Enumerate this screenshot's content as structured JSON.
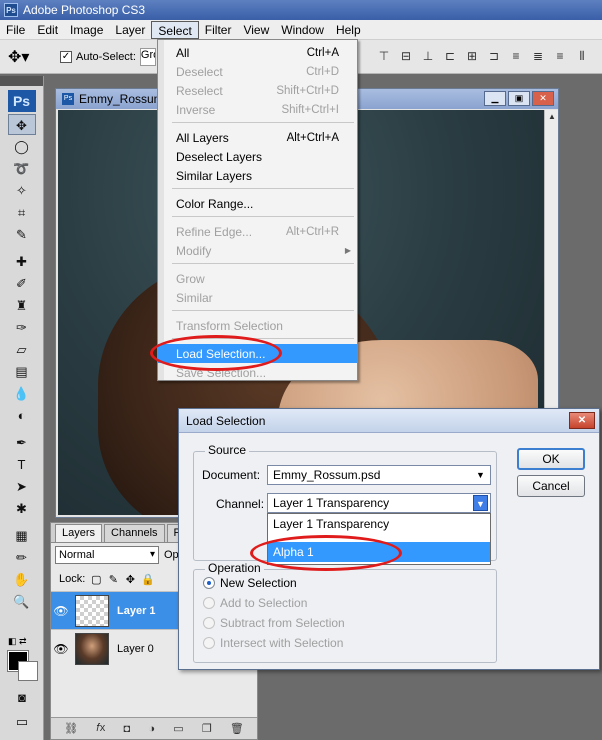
{
  "app": {
    "title": "Adobe Photoshop CS3",
    "badge": "Ps"
  },
  "menubar": {
    "items": [
      "File",
      "Edit",
      "Image",
      "Layer",
      "Select",
      "Filter",
      "View",
      "Window",
      "Help"
    ],
    "active_index": 4
  },
  "options_bar": {
    "auto_select_label": "Auto-Select:",
    "auto_select_checked": "✓",
    "auto_select_value": "Gro"
  },
  "tools": {
    "logo": "Ps"
  },
  "document": {
    "title": "Emmy_Rossum",
    "badge": "Ps"
  },
  "select_menu": {
    "items": [
      {
        "label": "All",
        "shortcut": "Ctrl+A",
        "enabled": true
      },
      {
        "label": "Deselect",
        "shortcut": "Ctrl+D",
        "enabled": false
      },
      {
        "label": "Reselect",
        "shortcut": "Shift+Ctrl+D",
        "enabled": false
      },
      {
        "label": "Inverse",
        "shortcut": "Shift+Ctrl+I",
        "enabled": false
      },
      {
        "label": "All Layers",
        "shortcut": "Alt+Ctrl+A",
        "enabled": true
      },
      {
        "label": "Deselect Layers",
        "shortcut": "",
        "enabled": true
      },
      {
        "label": "Similar Layers",
        "shortcut": "",
        "enabled": true
      },
      {
        "label": "Color Range...",
        "shortcut": "",
        "enabled": true
      },
      {
        "label": "Refine Edge...",
        "shortcut": "Alt+Ctrl+R",
        "enabled": false
      },
      {
        "label": "Modify",
        "shortcut": "",
        "enabled": false,
        "submenu": true
      },
      {
        "label": "Grow",
        "shortcut": "",
        "enabled": false
      },
      {
        "label": "Similar",
        "shortcut": "",
        "enabled": false
      },
      {
        "label": "Transform Selection",
        "shortcut": "",
        "enabled": false
      },
      {
        "label": "Load Selection...",
        "shortcut": "",
        "enabled": true,
        "highlighted": true
      },
      {
        "label": "Save Selection...",
        "shortcut": "",
        "enabled": false
      }
    ]
  },
  "layers_panel": {
    "tabs": [
      "Layers",
      "Channels",
      "P"
    ],
    "blend_mode": "Normal",
    "opacity_label": "Opa",
    "lock_label": "Lock:",
    "layers": [
      {
        "name": "Layer 1",
        "selected": true,
        "thumbnail": "transparent"
      },
      {
        "name": "Layer 0",
        "selected": false,
        "thumbnail": "photo"
      }
    ]
  },
  "load_selection_dialog": {
    "title": "Load Selection",
    "source_legend": "Source",
    "document_label": "Document:",
    "document_value": "Emmy_Rossum.psd",
    "channel_label": "Channel:",
    "channel_value": "Layer 1 Transparency",
    "channel_options": [
      "Layer 1 Transparency",
      "Alpha 1"
    ],
    "channel_highlighted_index": 1,
    "operation_legend": "Operation",
    "operations": [
      {
        "label": "New Selection",
        "selected": true,
        "enabled": true
      },
      {
        "label": "Add to Selection",
        "selected": false,
        "enabled": false
      },
      {
        "label": "Subtract from Selection",
        "selected": false,
        "enabled": false
      },
      {
        "label": "Intersect with Selection",
        "selected": false,
        "enabled": false
      }
    ],
    "ok_label": "OK",
    "cancel_label": "Cancel"
  },
  "colors": {
    "highlight": "#3399ff",
    "annotation": "#e01b1b",
    "titlebar": "#3a5fa8"
  }
}
